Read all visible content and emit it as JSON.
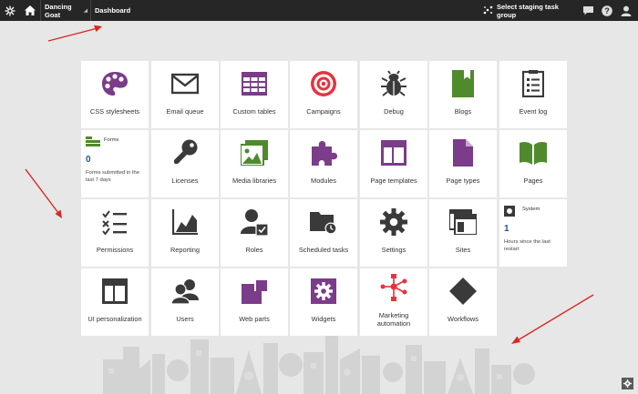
{
  "topbar": {
    "site_name": "Dancing Goat",
    "app_name": "Dashboard",
    "staging_label": "Select staging task group",
    "icons": [
      "kentico-logo-icon",
      "home-icon",
      "staging-icon",
      "chat-icon",
      "help-icon",
      "user-icon"
    ]
  },
  "tiles": {
    "css_stylesheets": "CSS stylesheets",
    "email_queue": "Email queue",
    "custom_tables": "Custom tables",
    "campaigns": "Campaigns",
    "debug": "Debug",
    "blogs": "Blogs",
    "event_log": "Event log",
    "licenses": "Licenses",
    "media_libraries": "Media libraries",
    "modules": "Modules",
    "page_templates": "Page templates",
    "page_types": "Page types",
    "pages": "Pages",
    "permissions": "Permissions",
    "reporting": "Reporting",
    "roles": "Roles",
    "scheduled_tasks": "Scheduled tasks",
    "settings": "Settings",
    "sites": "Sites",
    "ui_personalization": "UI personalization",
    "users": "Users",
    "web_parts": "Web parts",
    "widgets": "Widgets",
    "marketing_automation": "Marketing automation",
    "workflows": "Workflows"
  },
  "widgets": {
    "forms": {
      "title": "Forms",
      "value": "0",
      "desc": "Forms submitted in the last 7 days"
    },
    "system": {
      "title": "System",
      "value": "1",
      "desc": "Hours since the last restart"
    }
  },
  "colors": {
    "topbar": "#262626",
    "purple": "#7b3c8a",
    "green": "#4f8a2c",
    "red": "#e6323e",
    "dark": "#3a3a3a",
    "value_blue": "#1f5a8c",
    "arrow": "#d9281f"
  }
}
